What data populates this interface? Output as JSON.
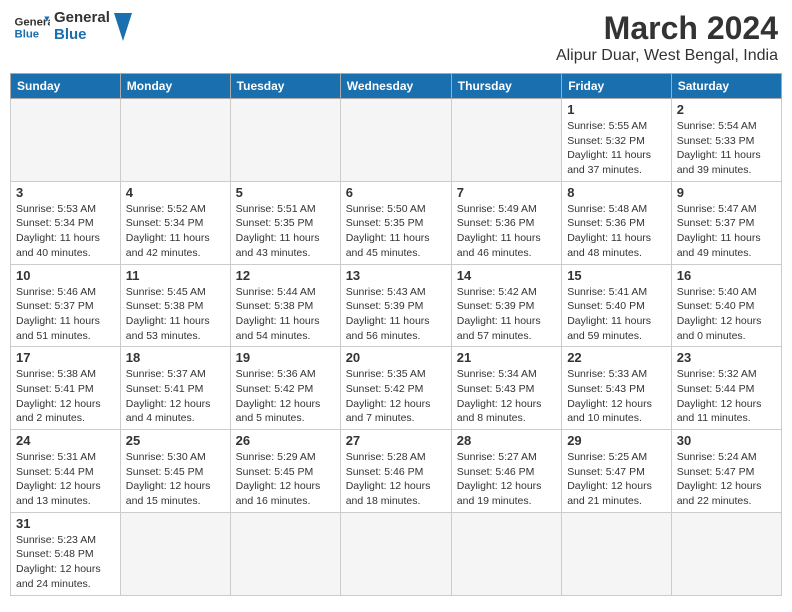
{
  "header": {
    "logo_general": "General",
    "logo_blue": "Blue",
    "month_title": "March 2024",
    "location": "Alipur Duar, West Bengal, India"
  },
  "days_of_week": [
    "Sunday",
    "Monday",
    "Tuesday",
    "Wednesday",
    "Thursday",
    "Friday",
    "Saturday"
  ],
  "weeks": [
    [
      {
        "day": "",
        "info": ""
      },
      {
        "day": "",
        "info": ""
      },
      {
        "day": "",
        "info": ""
      },
      {
        "day": "",
        "info": ""
      },
      {
        "day": "",
        "info": ""
      },
      {
        "day": "1",
        "info": "Sunrise: 5:55 AM\nSunset: 5:32 PM\nDaylight: 11 hours\nand 37 minutes."
      },
      {
        "day": "2",
        "info": "Sunrise: 5:54 AM\nSunset: 5:33 PM\nDaylight: 11 hours\nand 39 minutes."
      }
    ],
    [
      {
        "day": "3",
        "info": "Sunrise: 5:53 AM\nSunset: 5:34 PM\nDaylight: 11 hours\nand 40 minutes."
      },
      {
        "day": "4",
        "info": "Sunrise: 5:52 AM\nSunset: 5:34 PM\nDaylight: 11 hours\nand 42 minutes."
      },
      {
        "day": "5",
        "info": "Sunrise: 5:51 AM\nSunset: 5:35 PM\nDaylight: 11 hours\nand 43 minutes."
      },
      {
        "day": "6",
        "info": "Sunrise: 5:50 AM\nSunset: 5:35 PM\nDaylight: 11 hours\nand 45 minutes."
      },
      {
        "day": "7",
        "info": "Sunrise: 5:49 AM\nSunset: 5:36 PM\nDaylight: 11 hours\nand 46 minutes."
      },
      {
        "day": "8",
        "info": "Sunrise: 5:48 AM\nSunset: 5:36 PM\nDaylight: 11 hours\nand 48 minutes."
      },
      {
        "day": "9",
        "info": "Sunrise: 5:47 AM\nSunset: 5:37 PM\nDaylight: 11 hours\nand 49 minutes."
      }
    ],
    [
      {
        "day": "10",
        "info": "Sunrise: 5:46 AM\nSunset: 5:37 PM\nDaylight: 11 hours\nand 51 minutes."
      },
      {
        "day": "11",
        "info": "Sunrise: 5:45 AM\nSunset: 5:38 PM\nDaylight: 11 hours\nand 53 minutes."
      },
      {
        "day": "12",
        "info": "Sunrise: 5:44 AM\nSunset: 5:38 PM\nDaylight: 11 hours\nand 54 minutes."
      },
      {
        "day": "13",
        "info": "Sunrise: 5:43 AM\nSunset: 5:39 PM\nDaylight: 11 hours\nand 56 minutes."
      },
      {
        "day": "14",
        "info": "Sunrise: 5:42 AM\nSunset: 5:39 PM\nDaylight: 11 hours\nand 57 minutes."
      },
      {
        "day": "15",
        "info": "Sunrise: 5:41 AM\nSunset: 5:40 PM\nDaylight: 11 hours\nand 59 minutes."
      },
      {
        "day": "16",
        "info": "Sunrise: 5:40 AM\nSunset: 5:40 PM\nDaylight: 12 hours\nand 0 minutes."
      }
    ],
    [
      {
        "day": "17",
        "info": "Sunrise: 5:38 AM\nSunset: 5:41 PM\nDaylight: 12 hours\nand 2 minutes."
      },
      {
        "day": "18",
        "info": "Sunrise: 5:37 AM\nSunset: 5:41 PM\nDaylight: 12 hours\nand 4 minutes."
      },
      {
        "day": "19",
        "info": "Sunrise: 5:36 AM\nSunset: 5:42 PM\nDaylight: 12 hours\nand 5 minutes."
      },
      {
        "day": "20",
        "info": "Sunrise: 5:35 AM\nSunset: 5:42 PM\nDaylight: 12 hours\nand 7 minutes."
      },
      {
        "day": "21",
        "info": "Sunrise: 5:34 AM\nSunset: 5:43 PM\nDaylight: 12 hours\nand 8 minutes."
      },
      {
        "day": "22",
        "info": "Sunrise: 5:33 AM\nSunset: 5:43 PM\nDaylight: 12 hours\nand 10 minutes."
      },
      {
        "day": "23",
        "info": "Sunrise: 5:32 AM\nSunset: 5:44 PM\nDaylight: 12 hours\nand 11 minutes."
      }
    ],
    [
      {
        "day": "24",
        "info": "Sunrise: 5:31 AM\nSunset: 5:44 PM\nDaylight: 12 hours\nand 13 minutes."
      },
      {
        "day": "25",
        "info": "Sunrise: 5:30 AM\nSunset: 5:45 PM\nDaylight: 12 hours\nand 15 minutes."
      },
      {
        "day": "26",
        "info": "Sunrise: 5:29 AM\nSunset: 5:45 PM\nDaylight: 12 hours\nand 16 minutes."
      },
      {
        "day": "27",
        "info": "Sunrise: 5:28 AM\nSunset: 5:46 PM\nDaylight: 12 hours\nand 18 minutes."
      },
      {
        "day": "28",
        "info": "Sunrise: 5:27 AM\nSunset: 5:46 PM\nDaylight: 12 hours\nand 19 minutes."
      },
      {
        "day": "29",
        "info": "Sunrise: 5:25 AM\nSunset: 5:47 PM\nDaylight: 12 hours\nand 21 minutes."
      },
      {
        "day": "30",
        "info": "Sunrise: 5:24 AM\nSunset: 5:47 PM\nDaylight: 12 hours\nand 22 minutes."
      }
    ],
    [
      {
        "day": "31",
        "info": "Sunrise: 5:23 AM\nSunset: 5:48 PM\nDaylight: 12 hours\nand 24 minutes."
      },
      {
        "day": "",
        "info": ""
      },
      {
        "day": "",
        "info": ""
      },
      {
        "day": "",
        "info": ""
      },
      {
        "day": "",
        "info": ""
      },
      {
        "day": "",
        "info": ""
      },
      {
        "day": "",
        "info": ""
      }
    ]
  ]
}
